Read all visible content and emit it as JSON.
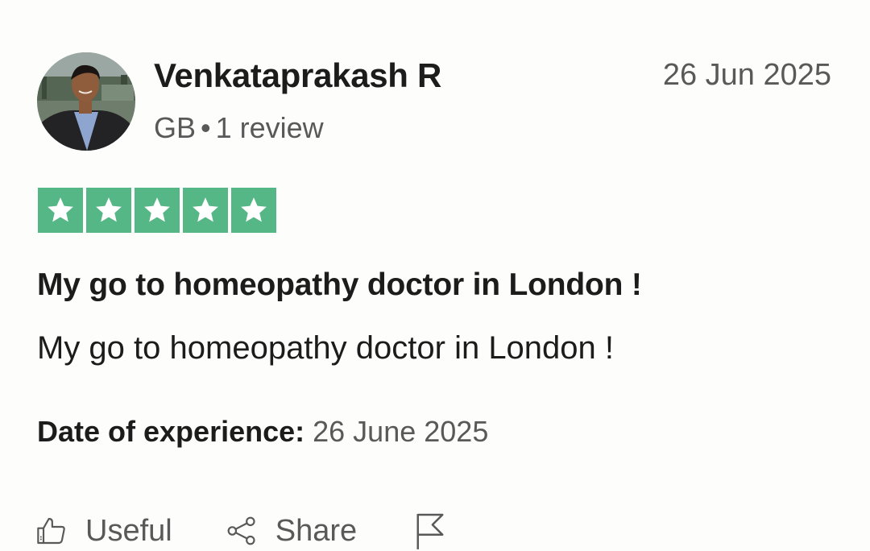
{
  "reviewer": {
    "name": "Venkataprakash R",
    "country": "GB",
    "separator": "•",
    "review_count": "1 review"
  },
  "review": {
    "date": "26 Jun 2025",
    "rating": 5,
    "rating_color": "#55b686",
    "title": "My go to homeopathy doctor in London !",
    "body": "My go to homeopathy doctor in London !",
    "experience_label": "Date of experience:",
    "experience_date": "26 June 2025"
  },
  "actions": {
    "useful_label": "Useful",
    "useful_icon": "thumbs-up-icon",
    "share_label": "Share",
    "share_icon": "share-icon",
    "report_icon": "flag-icon"
  }
}
